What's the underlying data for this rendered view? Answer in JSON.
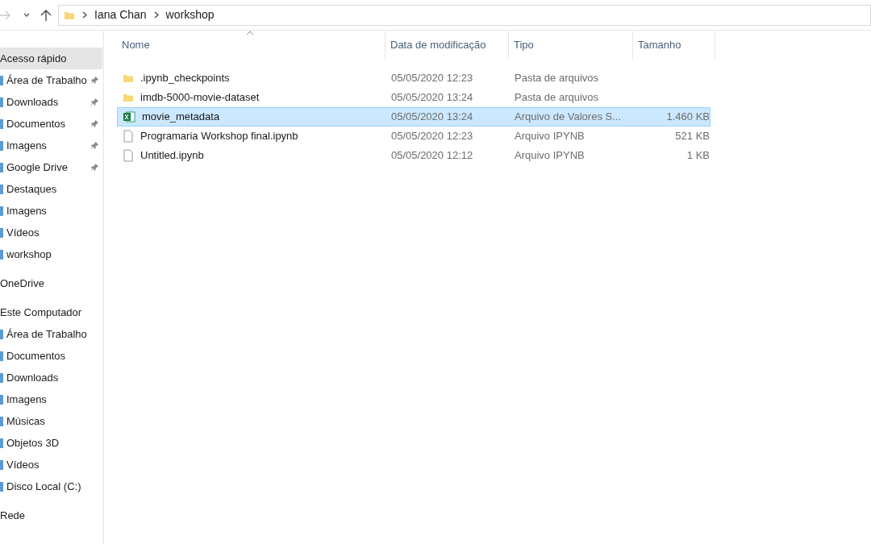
{
  "address_bar": {
    "path": [
      "Iana Chan",
      "workshop"
    ]
  },
  "sidebar": {
    "items": [
      {
        "kind": "header",
        "label": "Acesso rápido",
        "selected": true,
        "pinned": false
      },
      {
        "kind": "item",
        "label": "Área de Trabalho",
        "selected": false,
        "pinned": true
      },
      {
        "kind": "item",
        "label": "Downloads",
        "selected": false,
        "pinned": true
      },
      {
        "kind": "item",
        "label": "Documentos",
        "selected": false,
        "pinned": true
      },
      {
        "kind": "item",
        "label": "Imagens",
        "selected": false,
        "pinned": true
      },
      {
        "kind": "item",
        "label": "Google Drive",
        "selected": false,
        "pinned": true
      },
      {
        "kind": "item",
        "label": "Destaques",
        "selected": false,
        "pinned": false
      },
      {
        "kind": "item",
        "label": "Imagens",
        "selected": false,
        "pinned": false
      },
      {
        "kind": "item",
        "label": "Vídeos",
        "selected": false,
        "pinned": false
      },
      {
        "kind": "item",
        "label": "workshop",
        "selected": false,
        "pinned": false
      },
      {
        "kind": "header",
        "label": "OneDrive",
        "selected": false,
        "pinned": false
      },
      {
        "kind": "header",
        "label": "Este Computador",
        "selected": false,
        "pinned": false
      },
      {
        "kind": "item",
        "label": "Área de Trabalho",
        "selected": false,
        "pinned": false
      },
      {
        "kind": "item",
        "label": "Documentos",
        "selected": false,
        "pinned": false
      },
      {
        "kind": "item",
        "label": "Downloads",
        "selected": false,
        "pinned": false
      },
      {
        "kind": "item",
        "label": "Imagens",
        "selected": false,
        "pinned": false
      },
      {
        "kind": "item",
        "label": "Músicas",
        "selected": false,
        "pinned": false
      },
      {
        "kind": "item",
        "label": "Objetos 3D",
        "selected": false,
        "pinned": false
      },
      {
        "kind": "item",
        "label": "Vídeos",
        "selected": false,
        "pinned": false
      },
      {
        "kind": "item",
        "label": "Disco Local (C:)",
        "selected": false,
        "pinned": false
      },
      {
        "kind": "header",
        "label": "Rede",
        "selected": false,
        "pinned": false
      }
    ]
  },
  "table": {
    "columns": [
      "Nome",
      "Data de modificação",
      "Tipo",
      "Tamanho"
    ],
    "rows": [
      {
        "kind": "folder",
        "name": ".ipynb_checkpoints",
        "modified": "05/05/2020 12:23",
        "type": "Pasta de arquivos",
        "size": "",
        "selected": false
      },
      {
        "kind": "folder",
        "name": "imdb-5000-movie-dataset",
        "modified": "05/05/2020 13:24",
        "type": "Pasta de arquivos",
        "size": "",
        "selected": false
      },
      {
        "kind": "csv",
        "name": "movie_metadata",
        "modified": "05/05/2020 13:24",
        "type": "Arquivo de Valores S...",
        "size": "1.460 KB",
        "selected": true
      },
      {
        "kind": "file",
        "name": "Programaria Workshop final.ipynb",
        "modified": "05/05/2020 12:23",
        "type": "Arquivo IPYNB",
        "size": "521 KB",
        "selected": false
      },
      {
        "kind": "file",
        "name": "Untitled.ipynb",
        "modified": "05/05/2020 12:12",
        "type": "Arquivo IPYNB",
        "size": "1 KB",
        "selected": false
      }
    ]
  }
}
